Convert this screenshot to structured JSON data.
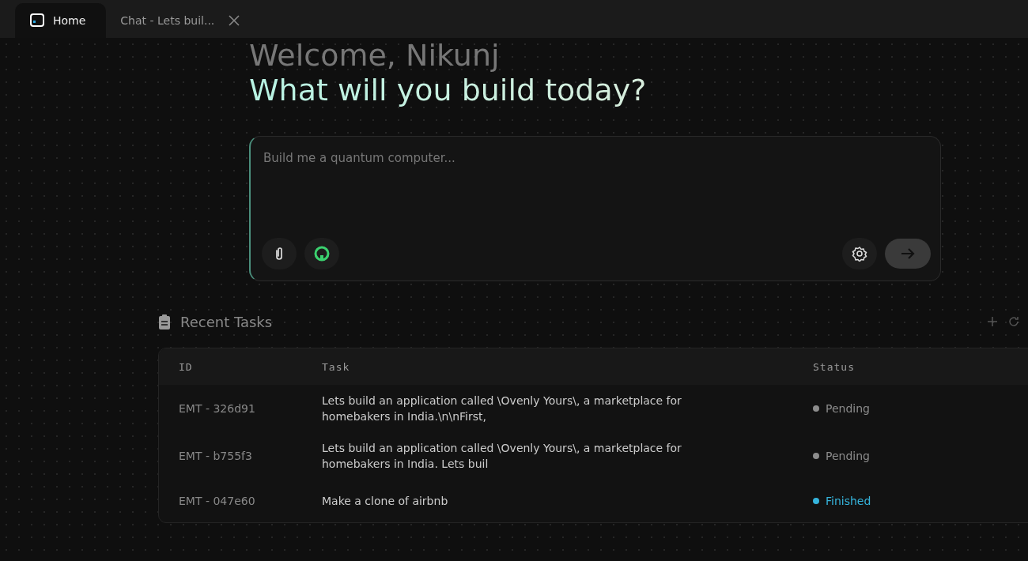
{
  "tabs": [
    {
      "label": "Home",
      "selected": true,
      "closable": false
    },
    {
      "label": "Chat - Lets buil...",
      "selected": false,
      "closable": true
    }
  ],
  "greeting": "Welcome, Nikunj",
  "headline": "What will you build today?",
  "prompt": {
    "placeholder": "Build me a quantum computer..."
  },
  "recent_tasks": {
    "title": "Recent Tasks",
    "columns": [
      "ID",
      "Task",
      "Status"
    ],
    "rows": [
      {
        "id": "EMT - 326d91",
        "task": "Lets build an application called \\Ovenly Yours\\, a marketplace for homebakers in India.\\n\\nFirst,",
        "status": "Pending",
        "color": "#8c8c8c"
      },
      {
        "id": "EMT - b755f3",
        "task": "Lets build an application called \\Ovenly Yours\\, a marketplace for homebakers in India. Lets buil",
        "status": "Pending",
        "color": "#8c8c8c"
      },
      {
        "id": "EMT - 047e60",
        "task": "Make a clone of airbnb",
        "status": "Finished",
        "color": "#35b4dc"
      }
    ]
  }
}
